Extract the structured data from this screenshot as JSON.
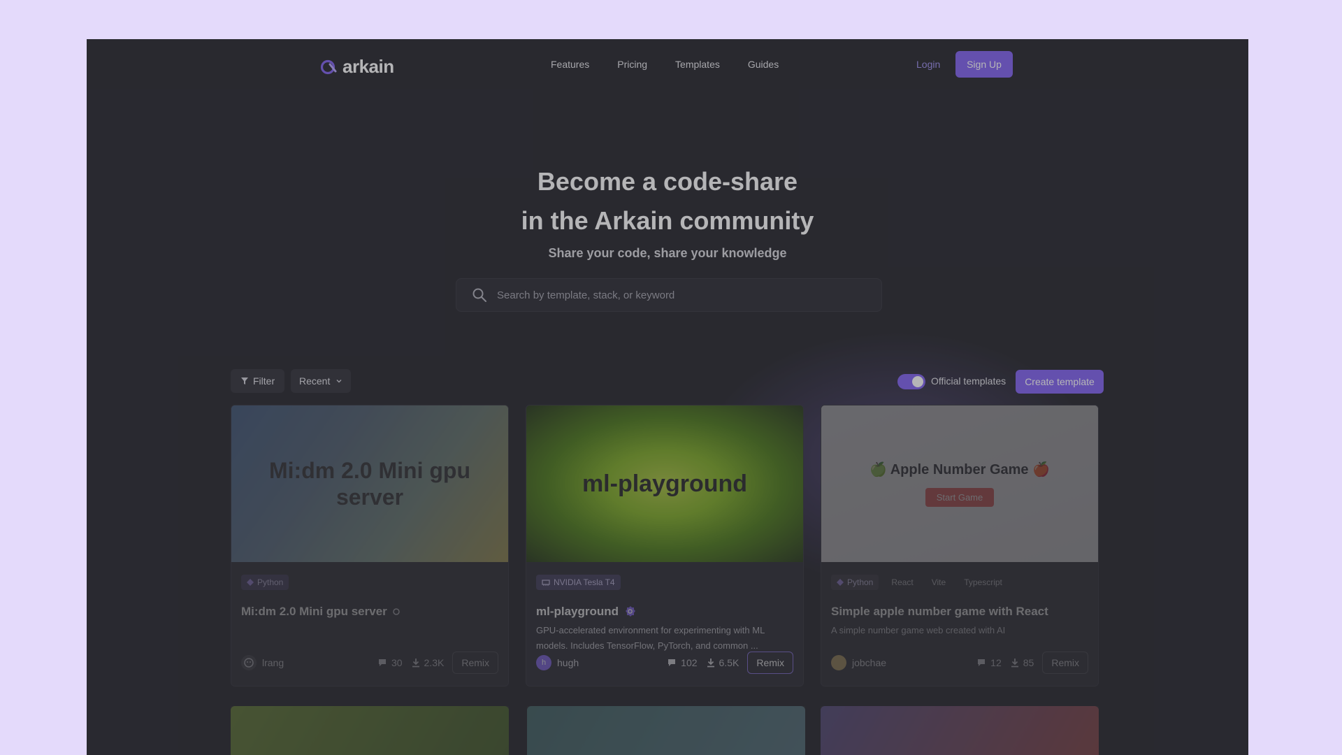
{
  "header": {
    "logo_text": "arkain",
    "nav": [
      "Features",
      "Pricing",
      "Templates",
      "Guides"
    ],
    "login": "Login",
    "signup": "Sign Up"
  },
  "hero": {
    "title_line1": "Become a code-share",
    "title_line2": "in the Arkain community",
    "subtitle": "Share your code, share your knowledge"
  },
  "search": {
    "placeholder": "Search by template, stack, or keyword"
  },
  "filters": {
    "filter_label": "Filter",
    "sort_label": "Recent",
    "toggle_label": "Official templates",
    "toggle_on": true,
    "create_label": "Create template"
  },
  "cards": [
    {
      "thumb_title": "Mi:dm 2.0 Mini gpu server",
      "tags": [
        "Python"
      ],
      "title": "Mi:dm 2.0 Mini gpu server",
      "description": "",
      "author": "lrang",
      "comments": "30",
      "downloads": "2.3K",
      "remix": "Remix"
    },
    {
      "thumb_title": "ml-playground",
      "tags": [
        "NVIDIA Tesla T4"
      ],
      "title": "ml-playground",
      "description": "GPU-accelerated environment for experimenting with ML models. Includes TensorFlow, PyTorch, and common ...",
      "author": "hugh",
      "author_initial": "h",
      "comments": "102",
      "downloads": "6.5K",
      "remix": "Remix"
    },
    {
      "thumb_title": "🍏 Apple Number Game 🍎",
      "thumb_button": "Start Game",
      "tags": [
        "Python",
        "React",
        "Vite",
        "Typescript"
      ],
      "title": "Simple apple number game with React",
      "description": "A simple number game web created with AI",
      "author": "jobchae",
      "comments": "12",
      "downloads": "85",
      "remix": "Remix"
    }
  ],
  "colors": {
    "accent": "#7c5cf0",
    "backdrop": "#e4dafb"
  }
}
